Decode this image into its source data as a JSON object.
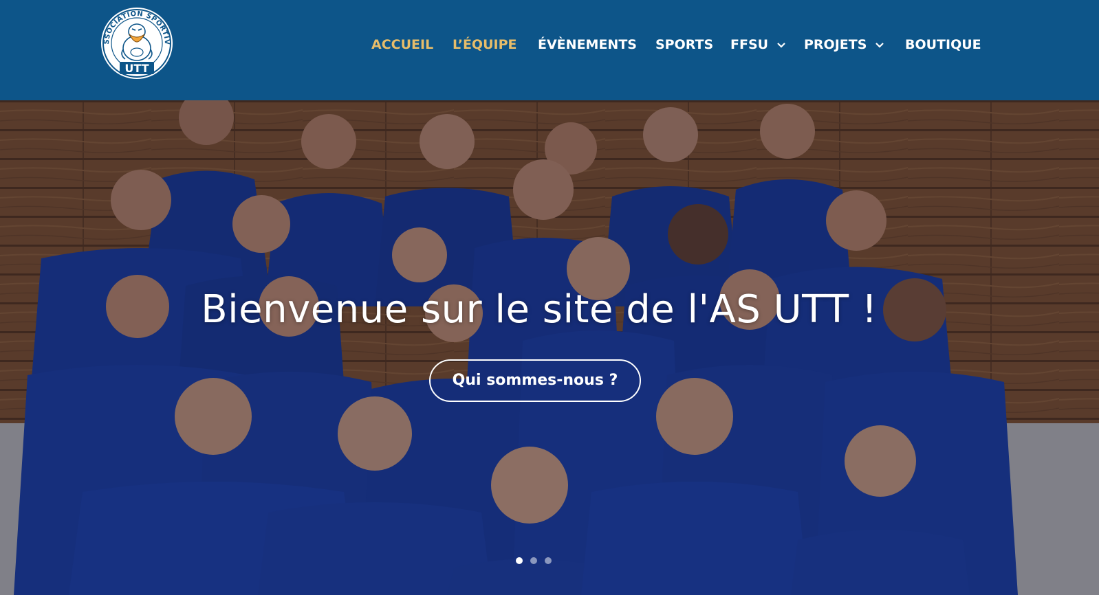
{
  "header": {
    "logo": {
      "text_top": "ASSOCIATION SPORTIVE",
      "text_bottom": "UTT",
      "icon": "duck-mascot-logo"
    },
    "colors": {
      "background": "#0d5589",
      "active": "#e7bd6a",
      "text": "#ffffff"
    },
    "nav": [
      {
        "label": "ACCUEIL",
        "active": true,
        "dropdown": false
      },
      {
        "label": "L’ÉQUIPE",
        "active": true,
        "dropdown": false
      },
      {
        "label": "ÉVÈNEMENTS",
        "active": false,
        "dropdown": false
      },
      {
        "label": "SPORTS",
        "active": false,
        "dropdown": false
      },
      {
        "label": "FFSU",
        "active": false,
        "dropdown": true,
        "icon": "chevron-down-icon"
      },
      {
        "label": "PROJETS",
        "active": false,
        "dropdown": true,
        "icon": "chevron-down-icon"
      },
      {
        "label": "BOUTIQUE",
        "active": false,
        "dropdown": false
      }
    ]
  },
  "hero": {
    "image": "team-photo-blue-jerseys",
    "title": "Bienvenue sur le site de l'AS UTT !",
    "cta_label": "Qui sommes-nous ?",
    "slider": {
      "slides": 3,
      "active_index": 0
    }
  }
}
